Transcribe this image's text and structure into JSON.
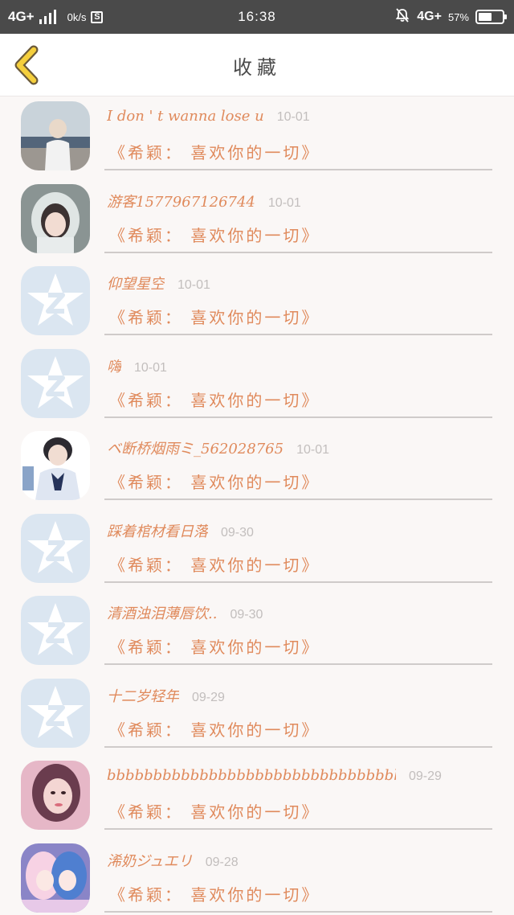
{
  "status_bar": {
    "network_left": "4G+",
    "speed": "0k/s",
    "s_badge": "S",
    "time": "16:38",
    "network_right": "4G+",
    "battery_pct": "57%",
    "battery_level": 0.57
  },
  "header": {
    "title": "收藏",
    "back_icon": "chevron-left-icon"
  },
  "colors": {
    "accent": "#e08a5c",
    "date": "#c2bebd",
    "back_fill": "#f5cf3d",
    "back_stroke": "#6b5a3a"
  },
  "favorites": [
    {
      "name": "I don ' t wanna lose u",
      "date": "10-01",
      "subtitle": "《希颖： 喜欢你的一切》",
      "avatar": "photo-sea"
    },
    {
      "name": "游客1577967126744",
      "date": "10-01",
      "subtitle": "《希颖： 喜欢你的一切》",
      "avatar": "photo-girl-hood"
    },
    {
      "name": "仰望星空",
      "date": "10-01",
      "subtitle": "《希颖： 喜欢你的一切》",
      "avatar": "default-star"
    },
    {
      "name": "嗨",
      "date": "10-01",
      "subtitle": "《希颖： 喜欢你的一切》",
      "avatar": "default-star"
    },
    {
      "name": "ベ断桥烟雨ミ_562028765",
      "date": "10-01",
      "subtitle": "《希颖： 喜欢你的一切》",
      "avatar": "photo-boy"
    },
    {
      "name": "踩着棺材看日落",
      "date": "09-30",
      "subtitle": "《希颖： 喜欢你的一切》",
      "avatar": "default-star"
    },
    {
      "name": "清酒浊泪薄唇饮..",
      "date": "09-30",
      "subtitle": "《希颖： 喜欢你的一切》",
      "avatar": "default-star"
    },
    {
      "name": "十二岁轻年",
      "date": "09-29",
      "subtitle": "《希颖： 喜欢你的一切》",
      "avatar": "default-star"
    },
    {
      "name": "bbbbbbbbbbbbbbbbbbbbbbbbbbbbbbbbbbbbbbbb",
      "date": "09-29",
      "subtitle": "《希颖： 喜欢你的一切》",
      "avatar": "photo-girl-pink"
    },
    {
      "name": "浠奶ジュエリ",
      "date": "09-28",
      "subtitle": "《希颖： 喜欢你的一切》",
      "avatar": "photo-anime"
    }
  ]
}
